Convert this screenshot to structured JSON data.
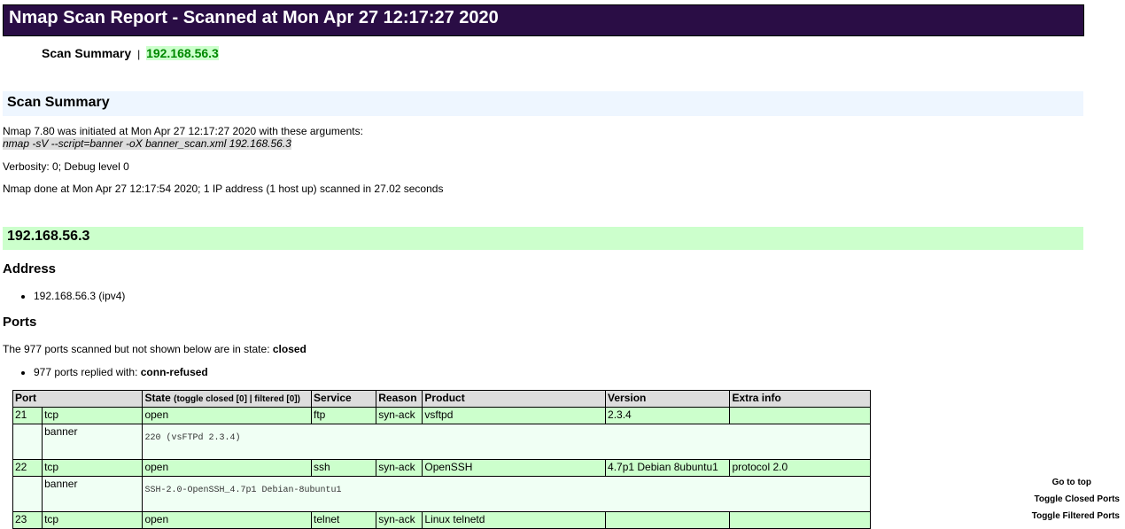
{
  "header": {
    "title": "Nmap Scan Report - Scanned at Mon Apr 27 12:17:27 2020"
  },
  "nav": {
    "title": "Scan Summary",
    "separator": "|",
    "host_link": "192.168.56.3"
  },
  "scan_summary": {
    "heading": "Scan Summary",
    "initiated": "Nmap 7.80 was initiated at Mon Apr 27 12:17:27 2020 with these arguments:",
    "arguments": "nmap -sV --script=banner -oX banner_scan.xml 192.168.56.3",
    "verbosity": "Verbosity: 0; Debug level 0",
    "done": "Nmap done at Mon Apr 27 12:17:54 2020; 1 IP address (1 host up) scanned in 27.02 seconds"
  },
  "host": {
    "heading": "192.168.56.3",
    "address_heading": "Address",
    "address_item": "192.168.56.3 (ipv4)",
    "ports_heading": "Ports",
    "closed_prefix": "The 977 ports scanned but not shown below are in state: ",
    "closed_state": "closed",
    "replied_prefix": "977 ports replied with: ",
    "replied_reason": "conn-refused"
  },
  "ports_table": {
    "headers": {
      "port": "Port",
      "state": "State",
      "toggle_prefix": "(toggle closed [0]",
      "toggle_sep": " | ",
      "toggle_filtered": "filtered [0])",
      "service": "Service",
      "reason": "Reason",
      "product": "Product",
      "version": "Version",
      "extra": "Extra info"
    },
    "rows": [
      {
        "port": "21",
        "proto": "tcp",
        "state": "open",
        "service": "ftp",
        "reason": "syn-ack",
        "product": "vsftpd",
        "version": "2.3.4",
        "extra": "",
        "script_name": "banner",
        "script_output": "220 (vsFTPd 2.3.4)"
      },
      {
        "port": "22",
        "proto": "tcp",
        "state": "open",
        "service": "ssh",
        "reason": "syn-ack",
        "product": "OpenSSH",
        "version": "4.7p1 Debian 8ubuntu1",
        "extra": "protocol 2.0",
        "script_name": "banner",
        "script_output": "SSH-2.0-OpenSSH_4.7p1 Debian-8ubuntu1"
      },
      {
        "port": "23",
        "proto": "tcp",
        "state": "open",
        "service": "telnet",
        "reason": "syn-ack",
        "product": "Linux telnetd",
        "version": "",
        "extra": ""
      }
    ]
  },
  "side_links": {
    "top": "Go to top",
    "closed": "Toggle Closed Ports",
    "filtered": "Toggle Filtered Ports"
  }
}
